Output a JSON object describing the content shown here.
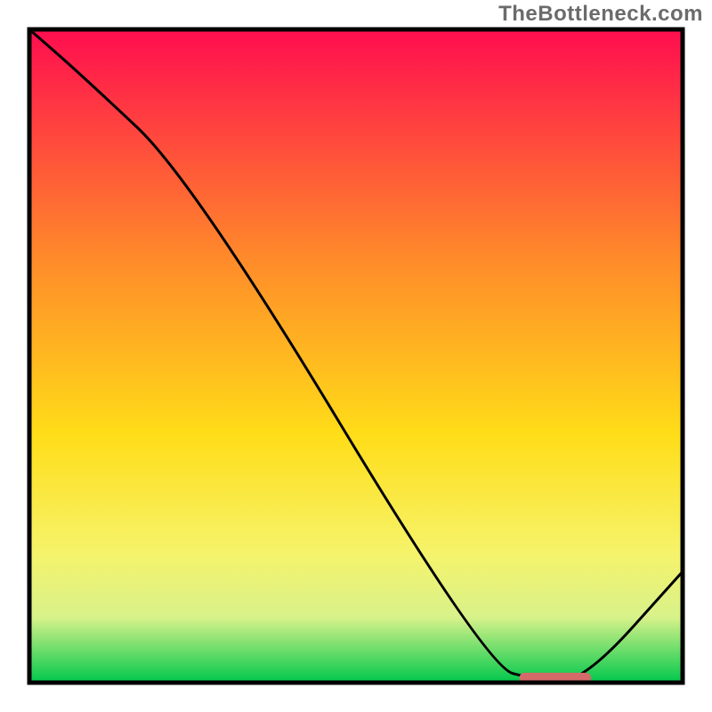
{
  "watermark": "TheBottleneck.com",
  "chart_data": {
    "type": "line",
    "title": "",
    "xlabel": "",
    "ylabel": "",
    "xlim": [
      0,
      100
    ],
    "ylim": [
      0,
      100
    ],
    "x": [
      0,
      8,
      25,
      70,
      78,
      85,
      100
    ],
    "values": [
      100,
      93,
      77,
      2.5,
      0.3,
      0.3,
      17
    ],
    "marker": {
      "x0": 75,
      "x1": 86,
      "y": 0.7
    },
    "colors": {
      "gradient_stops": [
        {
          "pct": 0,
          "color": "#ff0d4f"
        },
        {
          "pct": 35,
          "color": "#ff8a2a"
        },
        {
          "pct": 62,
          "color": "#ffdd18"
        },
        {
          "pct": 80,
          "color": "#f6f36a"
        },
        {
          "pct": 90,
          "color": "#d8f28a"
        },
        {
          "pct": 100,
          "color": "#00c84c"
        }
      ],
      "border": "#000000",
      "line": "#000000",
      "marker": "#d46a6a"
    },
    "layout": {
      "outer": 800,
      "inner_left": 33,
      "inner_top": 33,
      "inner_size": 734,
      "border_px": 5
    }
  }
}
